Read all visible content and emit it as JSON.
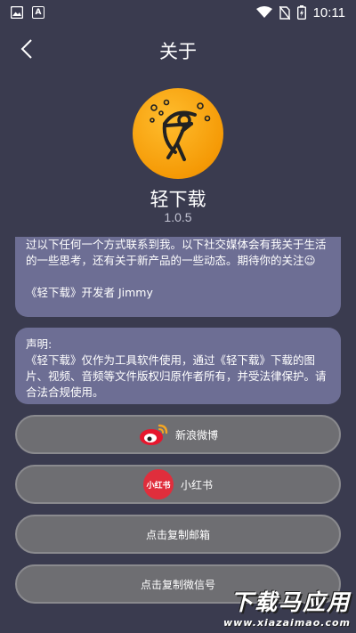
{
  "status_bar": {
    "time": "10:11",
    "left_icons": [
      "image-icon",
      "font-a-icon"
    ],
    "right_icons": [
      "wifi-icon",
      "no-sim-icon",
      "battery-charging-icon"
    ],
    "font_icon_letter": "A"
  },
  "header": {
    "title": "关于",
    "back_icon": "chevron-left-icon"
  },
  "app": {
    "name": "轻下载",
    "version": "1.0.5",
    "logo_icon": "archer-logo-icon"
  },
  "intro_card": {
    "text": "过以下任何一个方式联系到我。以下社交媒体会有我关于生活的一些思考，还有关于新产品的一些动态。期待你的关注😉",
    "signature": "《轻下载》开发者 Jimmy"
  },
  "notice_card": {
    "title": "声明:",
    "text": "《轻下载》仅作为工具软件使用，通过《轻下载》下载的图片、视频、音频等文件版权归原作者所有，并受法律保护。请合法合规使用。"
  },
  "buttons": {
    "weibo": "新浪微博",
    "xiaohongshu": "小红书",
    "xiaohongshu_logo_text": "小红书",
    "copy_email": "点击复制邮箱",
    "copy_wechat": "点击复制微信号"
  },
  "watermark": {
    "big": "下载马应用",
    "small": "www.xiazaimao.com"
  },
  "colors": {
    "background": "#3a3b4f",
    "card": "#6d6e94",
    "button": "#6e6e72",
    "logo": "#f59a06",
    "xhs_red": "#e02e3c"
  }
}
